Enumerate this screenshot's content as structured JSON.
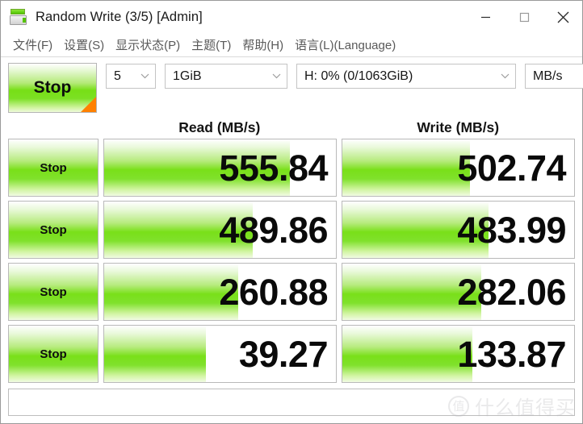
{
  "window": {
    "title": "Random Write (3/5) [Admin]",
    "icon": "disk-benchmark-icon",
    "controls": {
      "minimize": "minimize-icon",
      "maximize": "maximize-icon",
      "close": "close-icon"
    }
  },
  "menubar": {
    "items": [
      {
        "label": "文件(F)"
      },
      {
        "label": "设置(S)"
      },
      {
        "label": "显示状态(P)"
      },
      {
        "label": "主题(T)"
      },
      {
        "label": "帮助(H)"
      },
      {
        "label": "语言(L)(Language)"
      }
    ]
  },
  "toolbar": {
    "main_stop_label": "Stop",
    "combos": [
      {
        "name": "test-count",
        "value": "5"
      },
      {
        "name": "test-size",
        "value": "1GiB"
      },
      {
        "name": "target-drive",
        "value": "H: 0% (0/1063GiB)"
      },
      {
        "name": "unit",
        "value": "MB/s"
      }
    ]
  },
  "headers": {
    "read": "Read (MB/s)",
    "write": "Write (MB/s)"
  },
  "rows": [
    {
      "stop_label": "Stop",
      "read": {
        "value": "555.84",
        "bar_percent": 80
      },
      "write": {
        "value": "502.74",
        "bar_percent": 55
      }
    },
    {
      "stop_label": "Stop",
      "read": {
        "value": "489.86",
        "bar_percent": 64
      },
      "write": {
        "value": "483.99",
        "bar_percent": 63
      }
    },
    {
      "stop_label": "Stop",
      "read": {
        "value": "260.88",
        "bar_percent": 58
      },
      "write": {
        "value": "282.06",
        "bar_percent": 60
      }
    },
    {
      "stop_label": "Stop",
      "read": {
        "value": "39.27",
        "bar_percent": 44
      },
      "write": {
        "value": "133.87",
        "bar_percent": 56
      }
    }
  ],
  "status_bar": {
    "text": ""
  },
  "watermark": {
    "badge": "值",
    "text": "什么值得买"
  },
  "colors": {
    "bar_green": "#79e019",
    "accent_orange": "#ff8000",
    "border": "#b9b9b9",
    "menu_text": "#595959"
  }
}
